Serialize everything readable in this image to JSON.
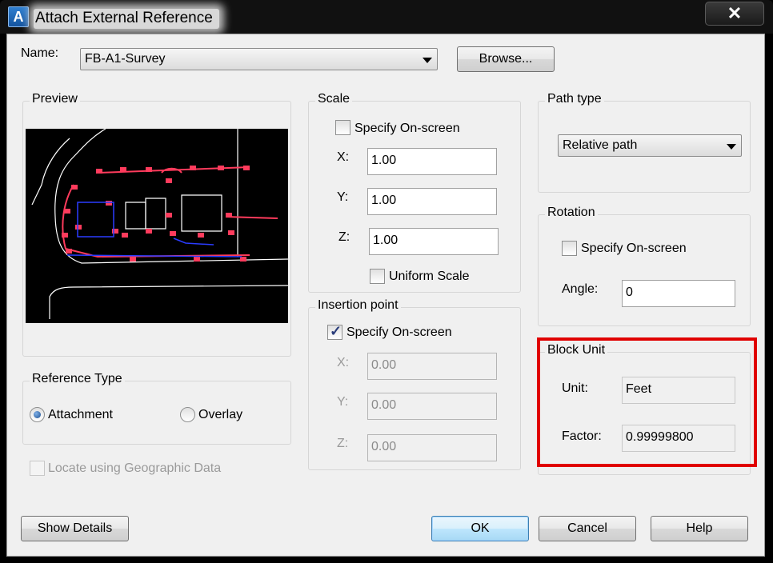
{
  "window": {
    "title": "Attach External Reference",
    "close_glyph": "✕",
    "app_icon_letter": "A"
  },
  "name_row": {
    "label": "Name:",
    "value": "FB-A1-Survey",
    "browse_label": "Browse..."
  },
  "preview": {
    "title": "Preview"
  },
  "scale": {
    "title": "Scale",
    "specify_onscreen_label": "Specify On-screen",
    "specify_onscreen_checked": false,
    "x_label": "X:",
    "x_value": "1.00",
    "y_label": "Y:",
    "y_value": "1.00",
    "z_label": "Z:",
    "z_value": "1.00",
    "uniform_label": "Uniform Scale",
    "uniform_checked": false
  },
  "insertion": {
    "title": "Insertion point",
    "specify_onscreen_label": "Specify On-screen",
    "specify_onscreen_checked": true,
    "x_label": "X:",
    "x_value": "0.00",
    "y_label": "Y:",
    "y_value": "0.00",
    "z_label": "Z:",
    "z_value": "0.00"
  },
  "path_type": {
    "title": "Path type",
    "value": "Relative path"
  },
  "rotation": {
    "title": "Rotation",
    "specify_onscreen_label": "Specify On-screen",
    "specify_onscreen_checked": false,
    "angle_label": "Angle:",
    "angle_value": "0"
  },
  "block_unit": {
    "title": "Block Unit",
    "unit_label": "Unit:",
    "unit_value": "Feet",
    "factor_label": "Factor:",
    "factor_value": "0.99999800"
  },
  "reference_type": {
    "title": "Reference Type",
    "attachment_label": "Attachment",
    "overlay_label": "Overlay",
    "selected": "Attachment"
  },
  "geo": {
    "label": "Locate using Geographic Data",
    "checked": false
  },
  "footer": {
    "show_details_label": "Show Details",
    "ok_label": "OK",
    "cancel_label": "Cancel",
    "help_label": "Help"
  },
  "colors": {
    "highlight": "#e00000",
    "preview_bg": "#000000",
    "preview_markup": "#ff3b5c",
    "preview_blue": "#2a3cff"
  }
}
